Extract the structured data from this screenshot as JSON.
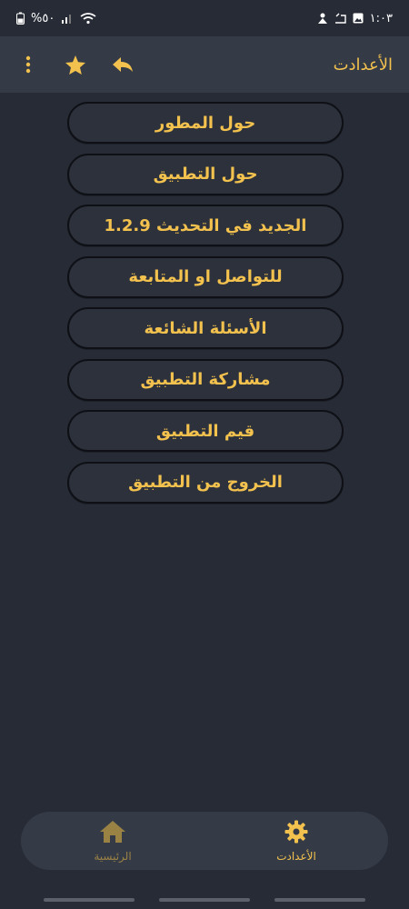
{
  "status_bar": {
    "time": "١:٠٣",
    "battery": "%٥٠"
  },
  "app_bar": {
    "title": "الأعدادت",
    "icons": [
      "more-vert-icon",
      "star-icon",
      "reply-icon"
    ]
  },
  "menu": {
    "items": [
      {
        "label": "حول المطور"
      },
      {
        "label": "حول التطبيق"
      },
      {
        "label": "الجديد في التحديث 1.2.9"
      },
      {
        "label": "للتواصل او المتابعة"
      },
      {
        "label": "الأسئلة الشائعة"
      },
      {
        "label": "مشاركة التطبيق"
      },
      {
        "label": "قيم التطبيق"
      },
      {
        "label": "الخروج من التطبيق"
      }
    ]
  },
  "bottom_nav": {
    "settings_label": "الأعدادت",
    "home_label": "الرئيسية"
  },
  "colors": {
    "background": "#262b36",
    "app_bar": "#353b46",
    "accent": "#f2c14e"
  }
}
